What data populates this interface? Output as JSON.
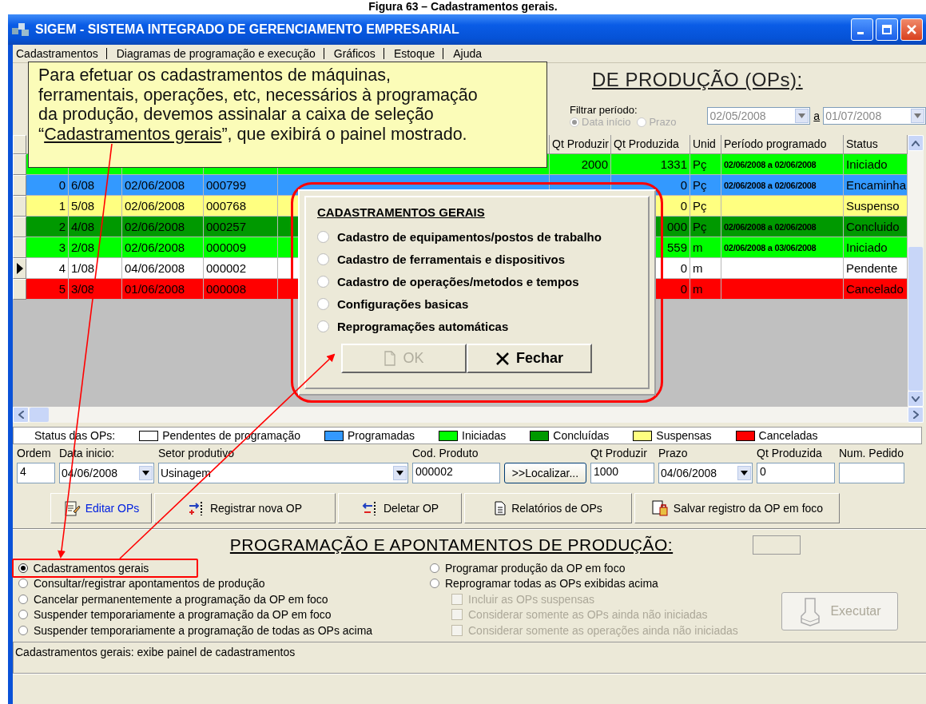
{
  "caption": "Figura 63 – Cadastramentos gerais.",
  "window": {
    "title": "SIGEM - SISTEMA INTEGRADO DE GERENCIAMENTO EMPRESARIAL"
  },
  "menu": [
    "Cadastramentos",
    "Diagramas de programação e execução",
    "Gráficos",
    "Estoque",
    "Ajuda"
  ],
  "heading": "DE PRODUÇÃO (OPs):",
  "filter": {
    "label": "Filtrar período:",
    "disabled": true,
    "options": [
      {
        "label": "Data início",
        "selected": true
      },
      {
        "label": "Prazo",
        "selected": false
      }
    ],
    "from": "02/05/2008",
    "to_label": "a",
    "to": "01/07/2008"
  },
  "table": {
    "columns": [
      "Qt Produzir",
      "Qt Produzida",
      "Unid",
      "Período programado",
      "Status"
    ],
    "rows": [
      {
        "color": "#00ff00",
        "selected": false,
        "qt_produzir": "2000",
        "qt_produzida": "1331",
        "unid": "Pç",
        "periodo": "02/06/2008 a 02/06/2008",
        "status": "Iniciado"
      },
      {
        "color": "#3399ff",
        "selected": false,
        "ordem": "0",
        "num_op": "6/08",
        "data_inicio": "02/06/2008",
        "cod_produto": "000799",
        "qt_produzida": "0",
        "unid": "Pç",
        "periodo": "02/06/2008 a 02/06/2008",
        "status": "Encaminha"
      },
      {
        "color": "#ffff80",
        "selected": false,
        "ordem": "1",
        "num_op": "5/08",
        "data_inicio": "02/06/2008",
        "cod_produto": "000768",
        "qt_produzida": "0",
        "unid": "Pç",
        "status": "Suspenso"
      },
      {
        "color": "#009900",
        "selected": false,
        "ordem": "2",
        "num_op": "4/08",
        "data_inicio": "02/06/2008",
        "cod_produto": "000257",
        "qt_produzida": "000",
        "unid": "Pç",
        "periodo": "02/06/2008 a 02/06/2008",
        "status": "Concluido"
      },
      {
        "color": "#00ff00",
        "selected": false,
        "ordem": "3",
        "num_op": "2/08",
        "data_inicio": "02/06/2008",
        "cod_produto": "000009",
        "qt_produzida": "559",
        "unid": "m",
        "periodo": "02/06/2008 a 03/06/2008",
        "status": "Iniciado"
      },
      {
        "color": "#ffffff",
        "selected": true,
        "ordem": "4",
        "num_op": "1/08",
        "data_inicio": "04/06/2008",
        "cod_produto": "000002",
        "qt_produzida": "0",
        "unid": "m",
        "status": "Pendente"
      },
      {
        "color": "#ff0000",
        "selected": false,
        "ordem": "5",
        "num_op": "3/08",
        "data_inicio": "01/06/2008",
        "cod_produto": "000008",
        "qt_produzida": "0",
        "unid": "m",
        "status": "Cancelado"
      }
    ]
  },
  "legend": {
    "label": "Status das OPs:",
    "items": [
      {
        "label": "Pendentes de programação",
        "color": "#ffffff"
      },
      {
        "label": "Programadas",
        "color": "#3399ff"
      },
      {
        "label": "Iniciadas",
        "color": "#00ff00"
      },
      {
        "label": "Concluídas",
        "color": "#009900"
      },
      {
        "label": "Suspensas",
        "color": "#ffff80"
      },
      {
        "label": "Canceladas",
        "color": "#ff0000"
      }
    ]
  },
  "form": [
    {
      "kind": "text",
      "label": "Ordem",
      "value": "4"
    },
    {
      "kind": "combo",
      "label": "Data inicio:",
      "value": "04/06/2008"
    },
    {
      "kind": "combo",
      "label": "Setor produtivo",
      "value": "Usinagem"
    },
    {
      "kind": "text",
      "label": "Cod. Produto",
      "value": "000002"
    },
    {
      "kind": "button",
      "value": ">>Localizar..."
    },
    {
      "kind": "text",
      "label": "Qt Produzir",
      "value": "1000"
    },
    {
      "kind": "combo",
      "label": "Prazo",
      "value": "04/06/2008"
    },
    {
      "kind": "text",
      "label": "Qt Produzida",
      "value": "0"
    },
    {
      "kind": "text",
      "label": "Num. Pedido"
    }
  ],
  "toolbar": [
    {
      "label": "Editar OPs",
      "active": true
    },
    {
      "label": "Registrar nova OP",
      "active": false
    },
    {
      "label": "Deletar OP",
      "active": false
    },
    {
      "label": "Relatórios de OPs",
      "active": false
    },
    {
      "label": "Salvar registro da OP em foco",
      "active": false
    }
  ],
  "section": {
    "heading": "PROGRAMAÇÃO E APONTAMENTOS DE PRODUÇÃO:",
    "options": [
      {
        "label": "Cadastramentos gerais",
        "selected": true
      },
      {
        "label": "Consultar/registrar apontamentos de produção",
        "selected": false
      },
      {
        "label": "Cancelar permanentemente a programação da OP em foco",
        "selected": false
      },
      {
        "label": "Suspender temporariamente a programação da OP em foco",
        "selected": false
      },
      {
        "label": "Suspender temporariamente a programação de todas as OPs acima",
        "selected": false
      }
    ],
    "options_right": [
      {
        "label": "Programar produção da OP em foco",
        "selected": false
      },
      {
        "label": "Reprogramar todas as OPs exibidas acima",
        "selected": false
      }
    ],
    "checkboxes": [
      {
        "label": "Incluir as OPs suspensas",
        "checked": false,
        "disabled": true
      },
      {
        "label": "Considerar somente as OPs ainda não iniciadas",
        "checked": false,
        "disabled": true
      },
      {
        "label": "Considerar somente as operações ainda não iniciadas",
        "checked": false,
        "disabled": true
      }
    ],
    "execute": {
      "label": "Executar",
      "disabled": true
    }
  },
  "status_text": "Cadastramentos gerais: exibe painel de cadastramentos",
  "callout": {
    "before": "Para efetuar os cadastramentos de máquinas,\nferramentais, operações, etc, necessários à programação\nda produção, devemos assinalar a caixa de seleção\n“",
    "underlined": "Cadastramentos gerais",
    "after": "”, que exibirá o painel mostrado."
  },
  "dialog": {
    "title": "CADASTRAMENTOS GERAIS",
    "options": [
      {
        "label": "Cadastro de equipamentos/postos de trabalho",
        "selected": false
      },
      {
        "label": "Cadastro de ferramentais e dispositivos",
        "selected": false
      },
      {
        "label": "Cadastro de operações/metodos e tempos",
        "selected": false
      },
      {
        "label": "Configurações basicas",
        "selected": false
      },
      {
        "label": "Reprogramações automáticas",
        "selected": false
      }
    ],
    "buttons": [
      {
        "label": "OK",
        "disabled": true
      },
      {
        "label": "Fechar",
        "disabled": false
      }
    ]
  }
}
